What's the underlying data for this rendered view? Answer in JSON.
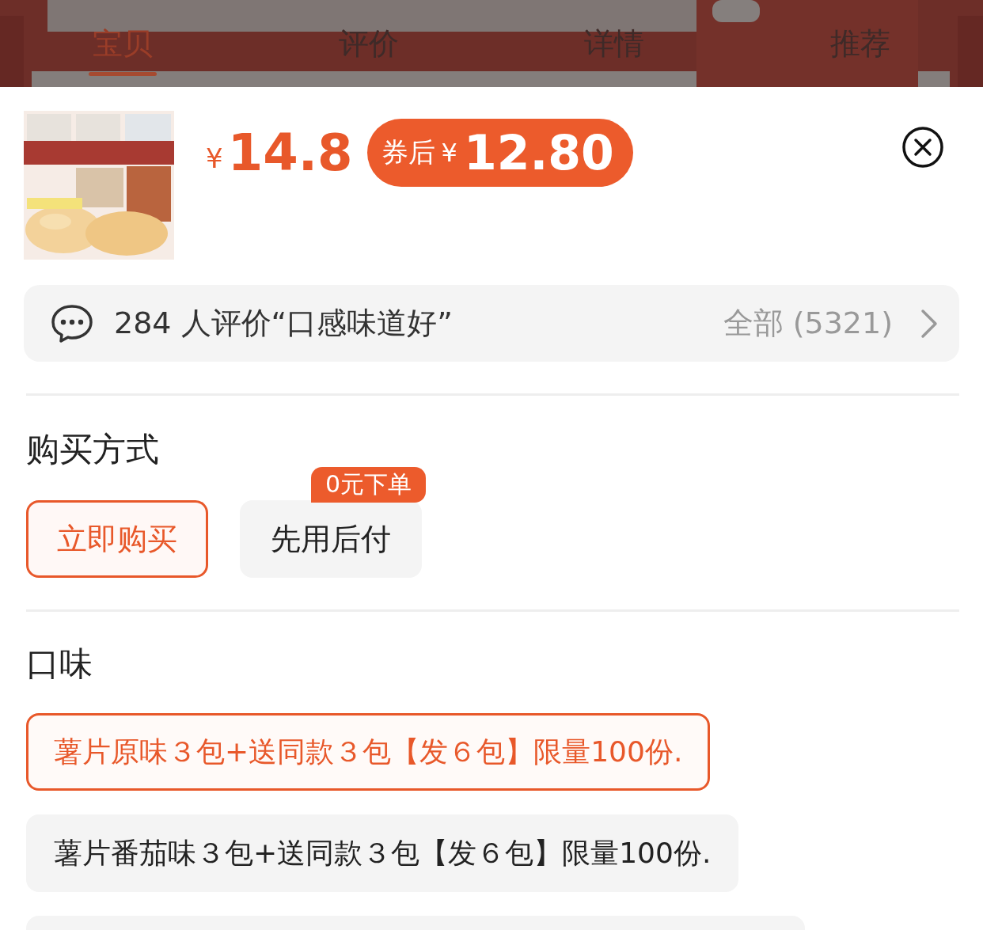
{
  "tabs": [
    {
      "label": "宝贝",
      "selected": true
    },
    {
      "label": "评价",
      "selected": false
    },
    {
      "label": "详情",
      "selected": false
    },
    {
      "label": "推荐",
      "selected": false
    }
  ],
  "product": {
    "currency": "¥",
    "price": "14.8",
    "coupon_label": "券后",
    "coupon_currency": "¥",
    "coupon_price": "12.80"
  },
  "reviews": {
    "summary": "284 人评价“口感味道好”",
    "all": "全部 (5321)"
  },
  "purchase": {
    "title": "购买方式",
    "options": [
      {
        "label": "立即购买",
        "selected": true
      },
      {
        "label": "先用后付",
        "selected": false,
        "badge": "0元下单"
      }
    ]
  },
  "flavor": {
    "title": "口味",
    "options": [
      {
        "label": "薯片原味３包+送同款３包【发６包】限量100份.",
        "selected": true
      },
      {
        "label": "薯片番茄味３包+送同款３包【发６包】限量100份.",
        "selected": false
      },
      {
        "selected": false
      }
    ]
  }
}
